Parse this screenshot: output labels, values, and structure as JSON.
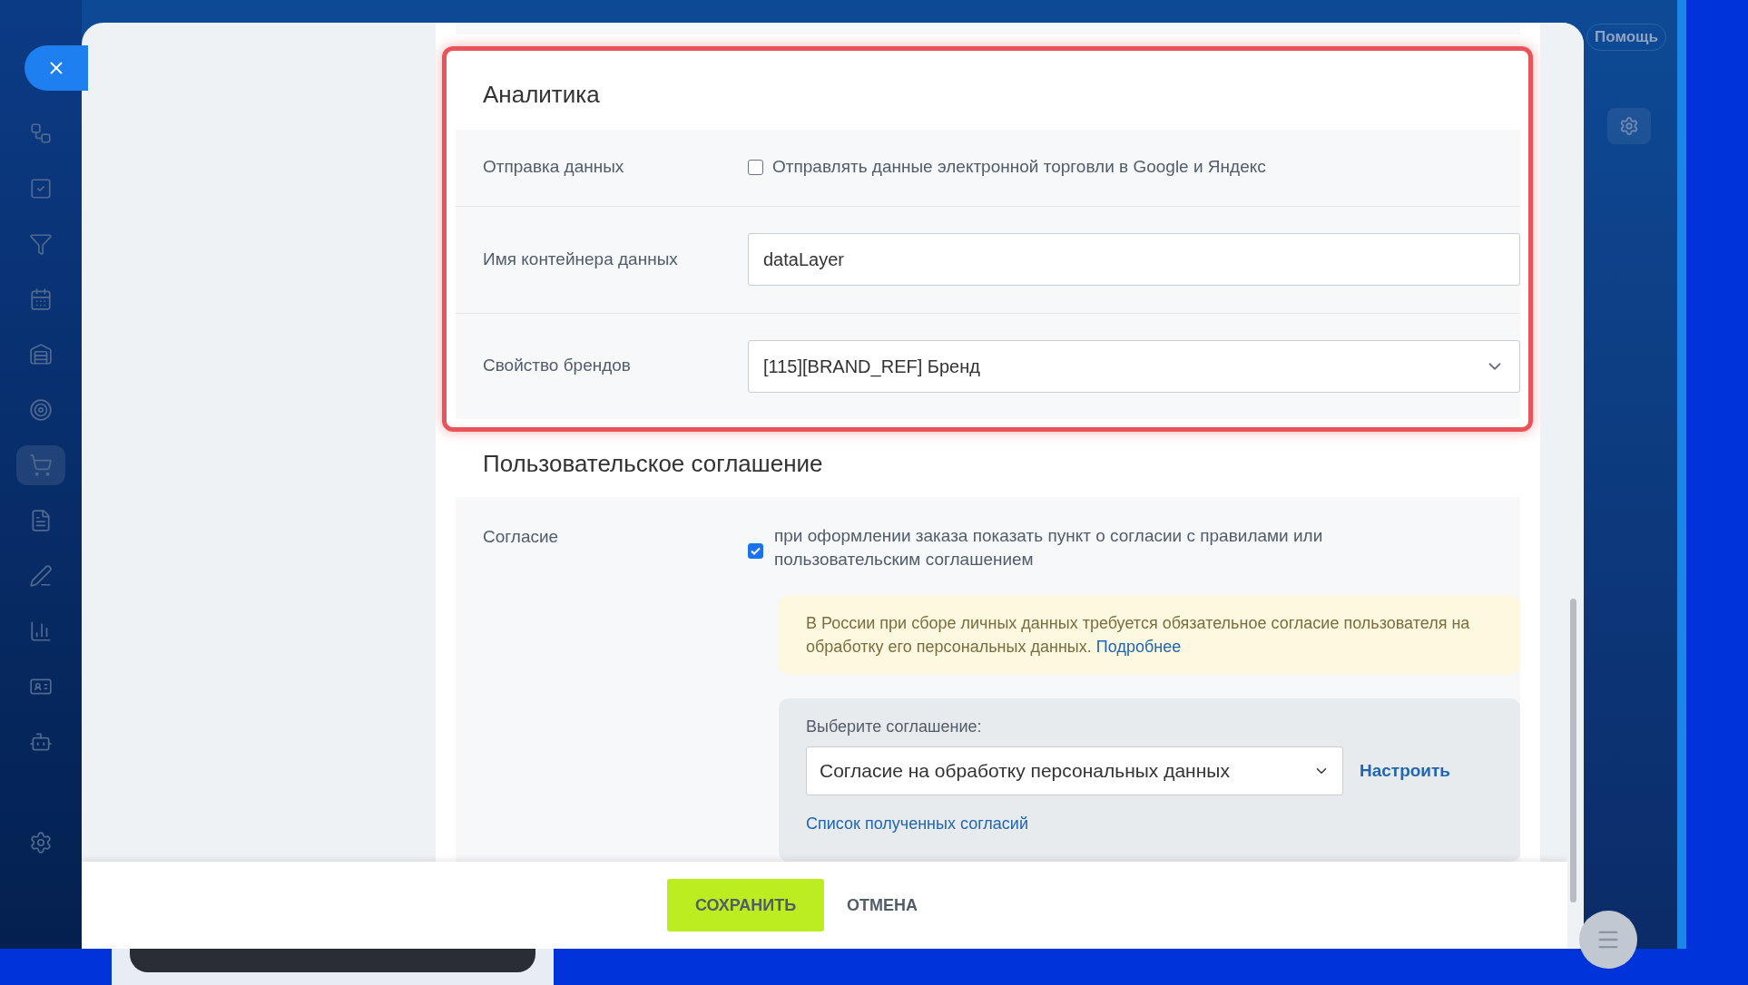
{
  "sidebar": {
    "items": [
      {
        "selected": false
      },
      {
        "selected": false
      },
      {
        "selected": false
      },
      {
        "selected": false
      },
      {
        "selected": false
      },
      {
        "selected": false
      },
      {
        "selected": true
      },
      {
        "selected": false
      },
      {
        "selected": false
      },
      {
        "selected": false
      },
      {
        "selected": false
      },
      {
        "selected": false
      },
      {
        "selected": false
      }
    ]
  },
  "header": {
    "help_button": "Помощь"
  },
  "analytics": {
    "title": "Аналитика",
    "highlighted": true,
    "send_data": {
      "label": "Отправка данных",
      "checkbox_label": "Отправлять данные электронной торговли в Google и Яндекс",
      "checked": false
    },
    "container_name": {
      "label": "Имя контейнера данных",
      "value": "dataLayer"
    },
    "brand_property": {
      "label": "Свойство брендов",
      "value": "[115][BRAND_REF] Бренд"
    }
  },
  "agreement": {
    "title": "Пользовательское соглашение",
    "label": "Согласие",
    "checkbox_label": "при оформлении заказа показать пункт о согласии с правилами или пользовательским соглашением",
    "checked": true,
    "notice": "В России при сборе личных данных требуется обязательное согласие пользователя на обработку его персональных данных.",
    "notice_link": "Подробнее",
    "choose_label": "Выберите соглашение:",
    "selected_agreement": "Согласие на обработку персональных данных",
    "configure_link": "Настроить",
    "list_link": "Список полученных согласий"
  },
  "footer": {
    "save_button": "СОХРАНИТЬ",
    "cancel_button": "ОТМЕНА"
  }
}
